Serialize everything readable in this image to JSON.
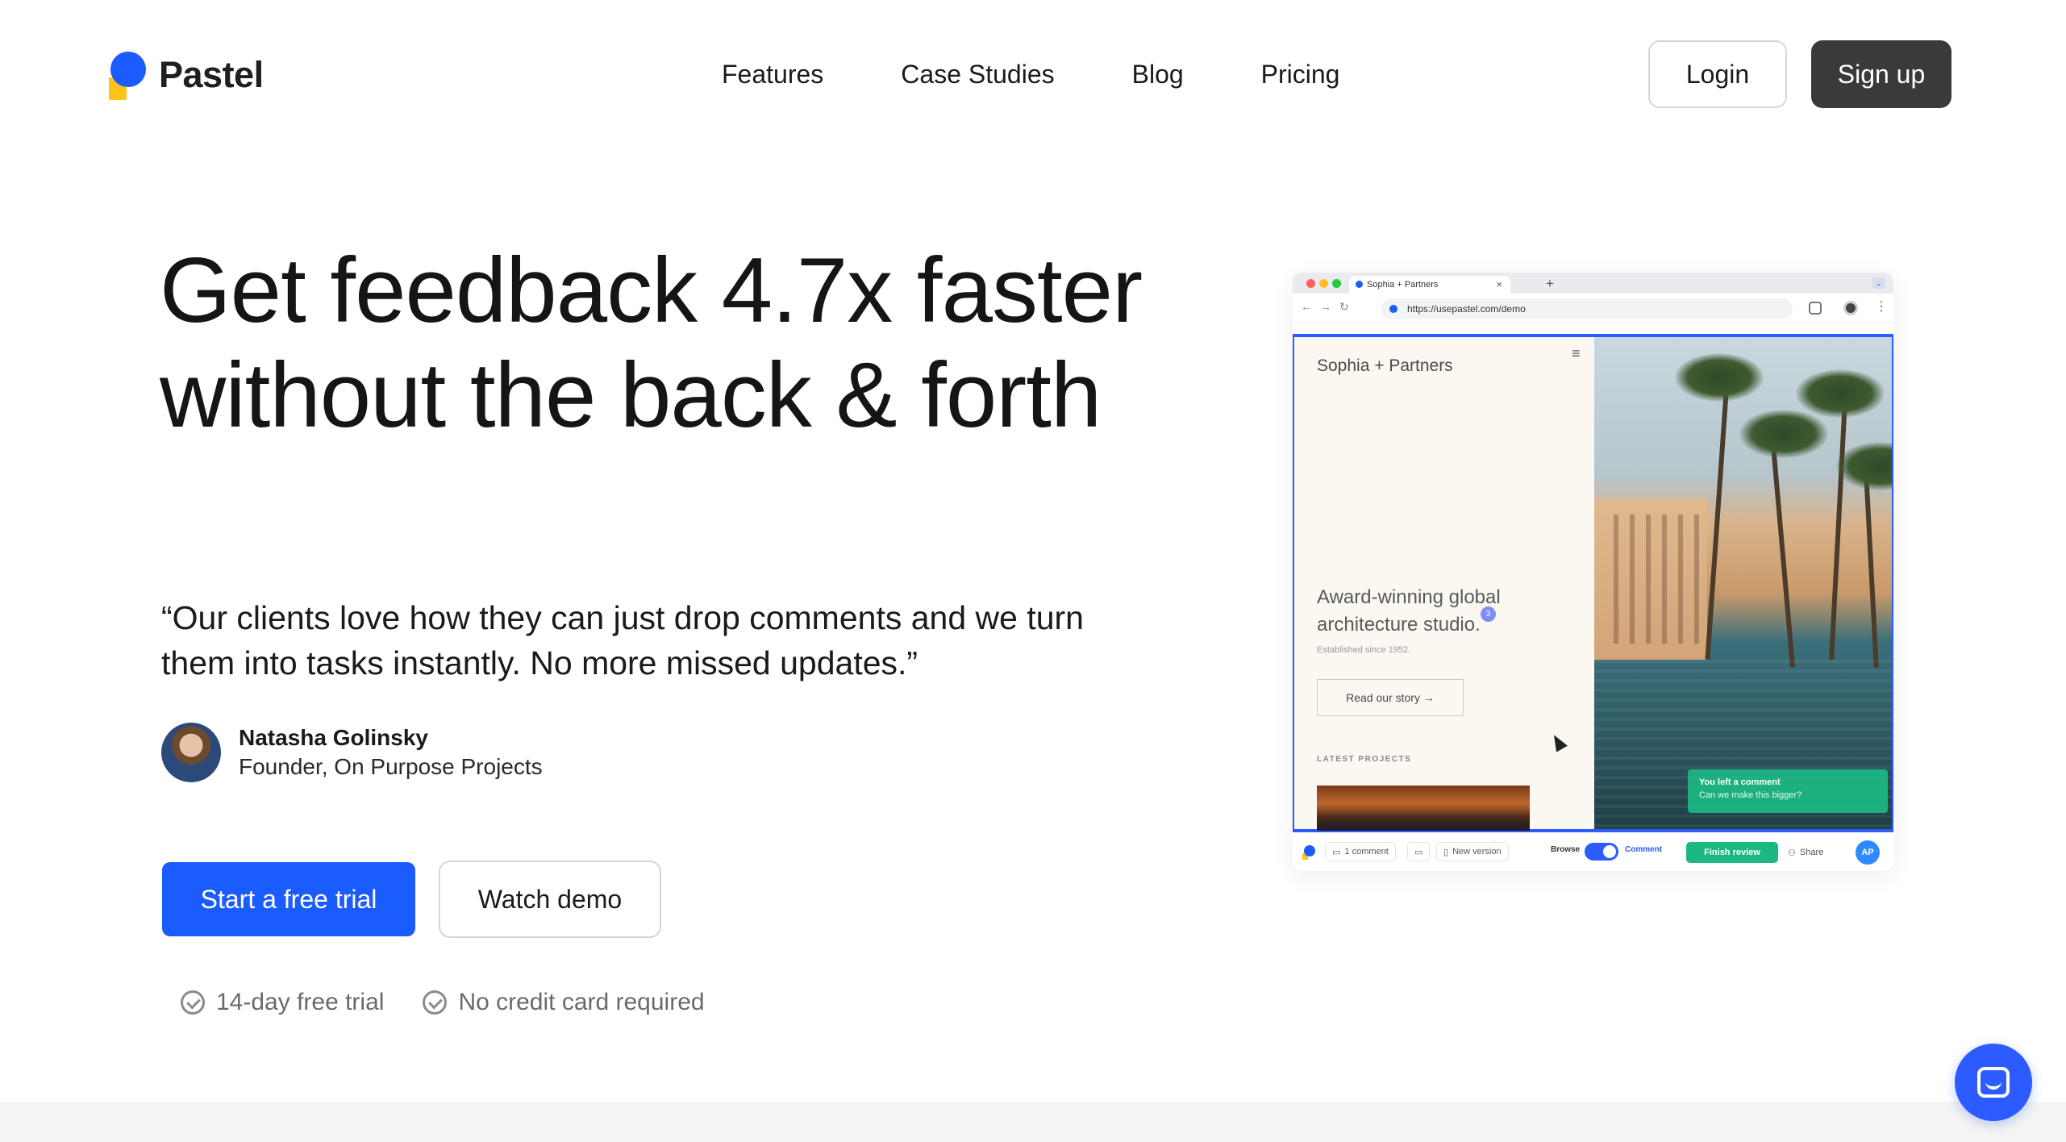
{
  "header": {
    "brand": "Pastel",
    "nav": [
      "Features",
      "Case Studies",
      "Blog",
      "Pricing"
    ],
    "login_label": "Login",
    "signup_label": "Sign up"
  },
  "hero": {
    "title": "Get feedback 4.7x faster without the back & forth",
    "quote": "“Our clients love how they can just drop comments and we turn them into tasks instantly. No more missed updates.”",
    "author_name": "Natasha Golinsky",
    "author_role": "Founder, On Purpose Projects",
    "cta_primary": "Start a free trial",
    "cta_secondary": "Watch demo",
    "perks": [
      "14-day free trial",
      "No credit card required"
    ]
  },
  "mock_browser": {
    "tab_title": "Sophia + Partners",
    "url": "https://usepastel.com/demo",
    "site": {
      "name": "Sophia + Partners",
      "headline": "Award-winning global architecture studio.",
      "comment_pin_number": "3",
      "established": "Established since 1952.",
      "read_story": "Read our story →",
      "latest_label": "LATEST PROJECTS"
    },
    "toast": {
      "title": "You left a comment",
      "subtitle": "Can we make this bigger?"
    },
    "toolbar": {
      "comments": "1 comment",
      "new_version": "New version",
      "browse": "Browse",
      "comment": "Comment",
      "finish_review": "Finish review",
      "share": "Share",
      "avatar_initials": "AP"
    }
  },
  "colors": {
    "brand_blue": "#1a5cff",
    "brand_yellow": "#ffc21a",
    "signup_bg": "#3a3a3a",
    "accent_green": "#1cb882"
  },
  "icons": {
    "chat": "chat-bubble-icon",
    "check": "check-circle-icon"
  }
}
